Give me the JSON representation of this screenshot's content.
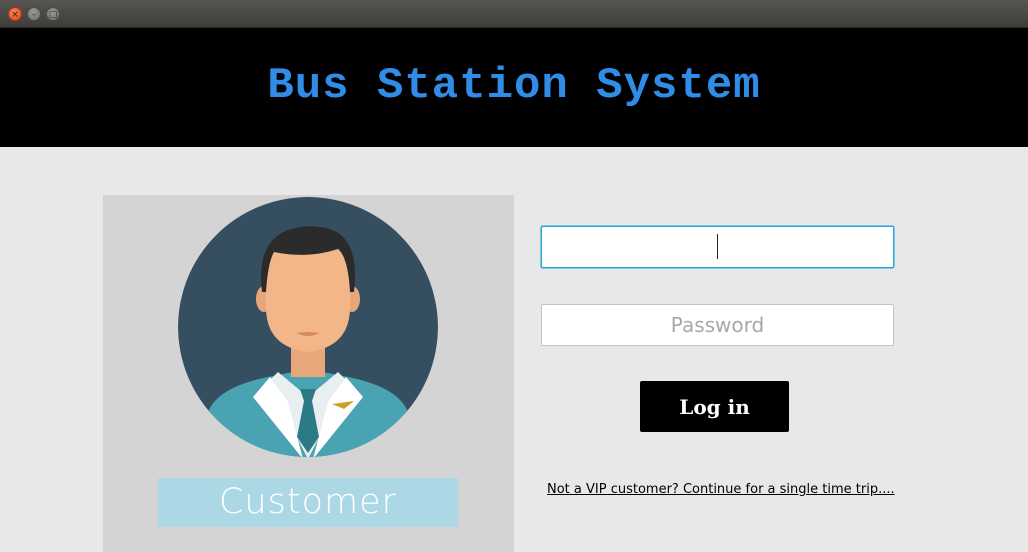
{
  "window": {
    "close_glyph": "×",
    "minimize_glyph": "–",
    "maximize_glyph": "□"
  },
  "header": {
    "title": "Bus Station System",
    "title_color": "#2f8de8",
    "background": "#000000"
  },
  "avatar": {
    "icon": "customer-avatar-icon",
    "role_label": "Customer"
  },
  "login_form": {
    "username_value": "",
    "password_placeholder": "Password",
    "login_label": "Log in",
    "guest_link": "Not a VIP customer? Continue for a single time trip...."
  }
}
